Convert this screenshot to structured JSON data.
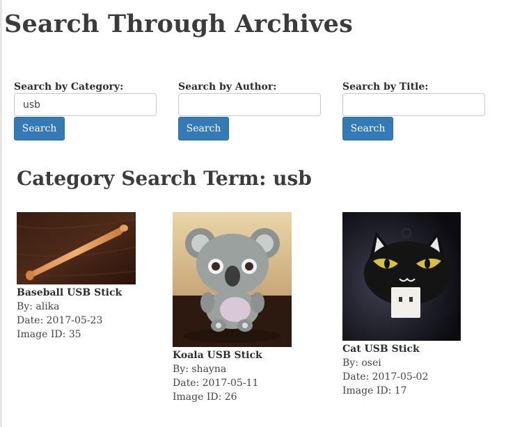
{
  "page": {
    "title": "Search Through Archives"
  },
  "search": {
    "category": {
      "label": "Search by Category:",
      "value": "usb",
      "button": "Search"
    },
    "author": {
      "label": "Search by Author:",
      "value": "",
      "button": "Search"
    },
    "title": {
      "label": "Search by Title:",
      "value": "",
      "button": "Search"
    }
  },
  "results": {
    "heading": "Category Search Term: usb",
    "items": [
      {
        "title": "Baseball USB Stick",
        "author": "By: alika",
        "date": "Date: 2017-05-23",
        "image_id": "Image ID: 35"
      },
      {
        "title": "Koala USB Stick",
        "author": "By: shayna",
        "date": "Date: 2017-05-11",
        "image_id": "Image ID: 26"
      },
      {
        "title": "Cat USB Stick",
        "author": "By: osei",
        "date": "Date: 2017-05-02",
        "image_id": "Image ID: 17"
      }
    ]
  },
  "colors": {
    "button_bg": "#337ab7",
    "heading_text": "#3b3b3b"
  }
}
